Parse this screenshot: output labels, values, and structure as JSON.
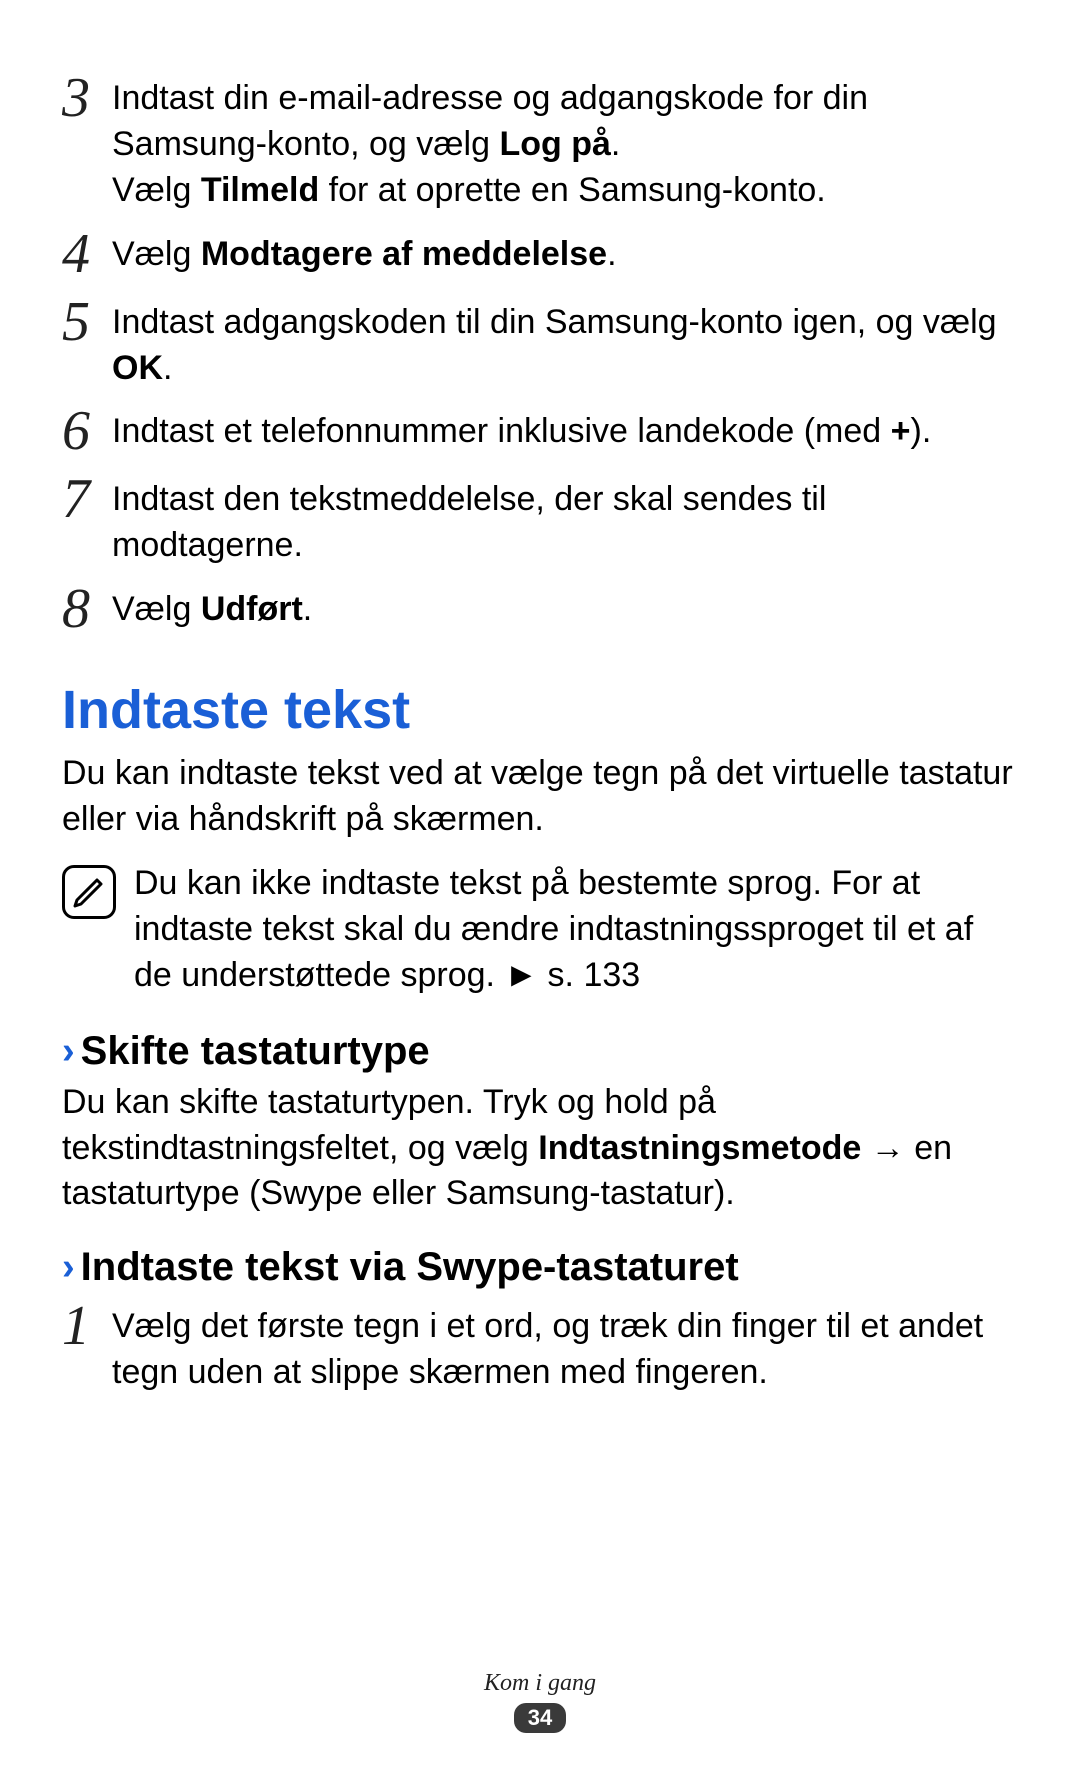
{
  "steps_a": [
    {
      "num": "3",
      "parts": [
        {
          "t": "Indtast din e-mail-adresse og adgangskode for din Samsung-konto, og vælg "
        },
        {
          "t": "Log på",
          "b": true
        },
        {
          "t": "."
        }
      ],
      "extra": [
        {
          "t": "Vælg "
        },
        {
          "t": "Tilmeld",
          "b": true
        },
        {
          "t": " for at oprette en Samsung-konto."
        }
      ]
    },
    {
      "num": "4",
      "parts": [
        {
          "t": "Vælg "
        },
        {
          "t": "Modtagere af meddelelse",
          "b": true
        },
        {
          "t": "."
        }
      ]
    },
    {
      "num": "5",
      "parts": [
        {
          "t": "Indtast adgangskoden til din Samsung-konto igen, og vælg "
        },
        {
          "t": "OK",
          "b": true
        },
        {
          "t": "."
        }
      ]
    },
    {
      "num": "6",
      "parts": [
        {
          "t": "Indtast et telefonnummer inklusive landekode (med "
        },
        {
          "t": "+",
          "b": true
        },
        {
          "t": ")."
        }
      ]
    },
    {
      "num": "7",
      "parts": [
        {
          "t": "Indtast den tekstmeddelelse, der skal sendes til modtagerne."
        }
      ]
    },
    {
      "num": "8",
      "parts": [
        {
          "t": "Vælg "
        },
        {
          "t": "Udført",
          "b": true
        },
        {
          "t": "."
        }
      ]
    }
  ],
  "section": {
    "title": "Indtaste tekst",
    "intro": "Du kan indtaste tekst ved at vælge tegn på det virtuelle tastatur eller via håndskrift på skærmen.",
    "note": "Du kan ikke indtaste tekst på bestemte sprog. For at indtaste tekst skal du ændre indtastningssproget til et af de understøttede sprog. ► s. 133"
  },
  "sub1": {
    "heading": "Skifte tastaturtype",
    "body_parts": [
      {
        "t": "Du kan skifte tastaturtypen. Tryk og hold på tekstindtastningsfeltet, og vælg "
      },
      {
        "t": "Indtastningsmetode",
        "b": true
      },
      {
        "t": " → en tastaturtype (Swype eller Samsung-tastatur)."
      }
    ]
  },
  "sub2": {
    "heading": "Indtaste tekst via Swype-tastaturet",
    "step": {
      "num": "1",
      "parts": [
        {
          "t": "Vælg det første tegn i et ord, og træk din finger til et andet tegn uden at slippe skærmen med fingeren."
        }
      ]
    }
  },
  "footer": {
    "label": "Kom i gang",
    "page": "34"
  }
}
